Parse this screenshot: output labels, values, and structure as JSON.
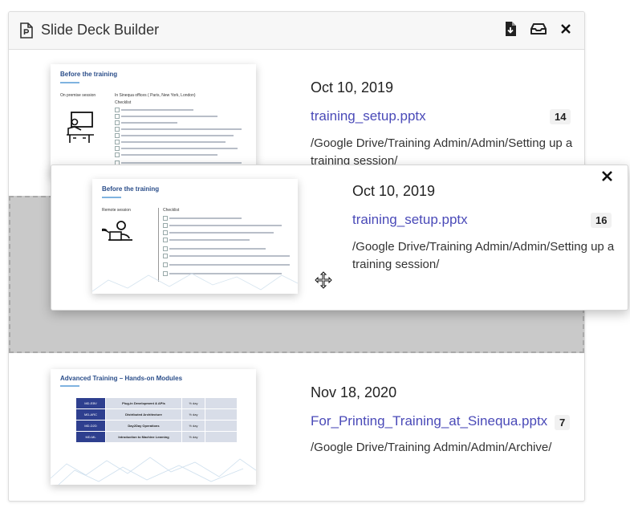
{
  "panel": {
    "title": "Slide Deck Builder",
    "icons": {
      "title": "pptx-file-icon",
      "download": "download-icon",
      "inbox": "inbox-icon",
      "close": "close-icon"
    }
  },
  "items": [
    {
      "date": "Oct 10, 2019",
      "filename": "training_setup.pptx",
      "count": "14",
      "path": "/Google Drive/Training Admin/Admin/Setting up a training session/",
      "slide": {
        "title": "Before the training",
        "left_label": "On premise session",
        "right_label": "In Sinequa offices ( Paris, New York, London)",
        "sub": "Checklist"
      }
    },
    {
      "date": "Nov 18, 2020",
      "filename": "For_Printing_Training_at_Sinequa.pptx",
      "count": "7",
      "path": "/Google Drive/Training Admin/Admin/Archive/",
      "slide": {
        "title": "Advanced Training – Hands-on Modules",
        "rows": [
          {
            "code": "MD-EBV",
            "name": "Plug-in Development & APIs",
            "days": "½ day"
          },
          {
            "code": "MD-ARC",
            "name": "Distributed Architecture",
            "days": "½ day"
          },
          {
            "code": "MD-D2D",
            "name": "Day2Day Operations",
            "days": "½ day"
          },
          {
            "code": "MD-ML",
            "name": "Introduction to Machine Learning",
            "days": "½ day"
          }
        ]
      }
    }
  ],
  "dragging": {
    "date": "Oct 10, 2019",
    "filename": "training_setup.pptx",
    "count": "16",
    "path": "/Google Drive/Training Admin/Admin/Setting up a training session/",
    "slide": {
      "title": "Before the training",
      "left_label": "Remote session",
      "sub": "Checklist"
    },
    "icons": {
      "close": "close-icon",
      "move": "move-cursor-icon"
    }
  }
}
